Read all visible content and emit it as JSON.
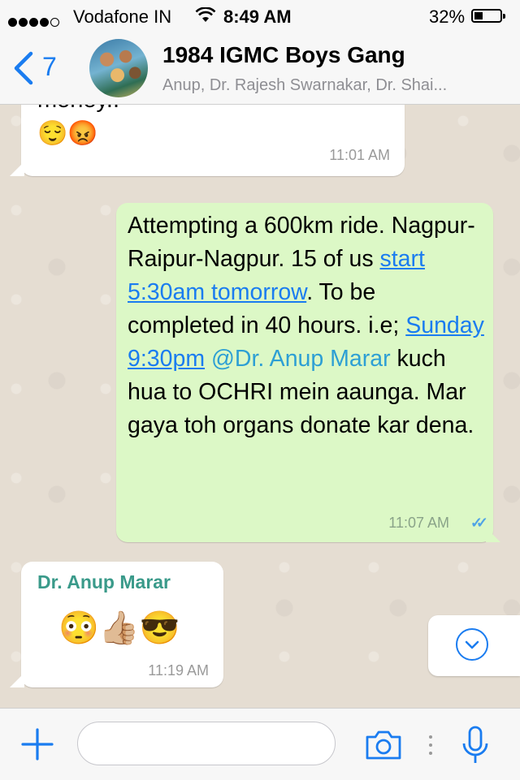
{
  "status_bar": {
    "carrier": "Vodafone IN",
    "time": "8:49 AM",
    "battery": "32%",
    "battery_level": 0.32,
    "signal_bars_filled": 4,
    "signal_bars_total": 5
  },
  "header": {
    "back_count": "7",
    "title": "1984 IGMC Boys Gang",
    "subtitle": "Anup, Dr. Rajesh Swarnakar, Dr. Shai..."
  },
  "messages": [
    {
      "direction": "incoming",
      "text": "money..",
      "emojis": "😌😡",
      "time": "11:01 AM"
    },
    {
      "direction": "outgoing",
      "part1": "Attempting a 600km ride. Nagpur-Raipur-Nagpur. 15 of us ",
      "link1": "start 5:30am tomorrow",
      "part2": ". To be completed in 40 hours. i.e; ",
      "link2": "Sunday 9:30pm",
      "part3": " ",
      "mention": "@Dr. Anup Marar",
      "part4": " kuch hua to OCHRI mein aaunga. Mar gaya toh organs donate kar dena.",
      "time": "11:07 AM",
      "ticks": "✓✓"
    },
    {
      "direction": "incoming",
      "sender": "Dr. Anup Marar",
      "emojis": "😳👍🏼😎",
      "time": "11:19 AM"
    }
  ],
  "input_bar": {
    "placeholder": "",
    "value": ""
  },
  "colors": {
    "accent": "#1a7cf0",
    "outgoing_bubble": "#dcf8c6",
    "incoming_bubble": "#ffffff",
    "sender_name": "#3a9a8a",
    "read_ticks": "#4fa3e6"
  }
}
